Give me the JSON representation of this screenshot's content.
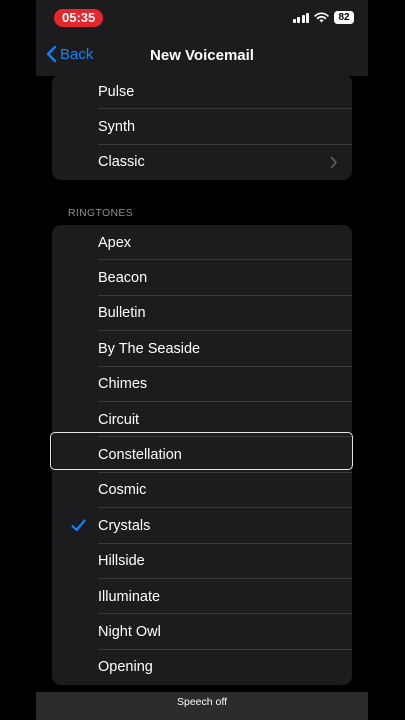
{
  "status_bar": {
    "time": "05:35",
    "battery": "82",
    "time_pill_color": "#e5262d"
  },
  "nav": {
    "back_label": "Back",
    "title": "New Voicemail",
    "accent_color": "#0a84ff"
  },
  "alert_tones": {
    "items": [
      {
        "label": "Pulse"
      },
      {
        "label": "Synth"
      },
      {
        "label": "Classic",
        "icon": "chevron-right-icon"
      }
    ]
  },
  "ringtones": {
    "header": "RINGTONES",
    "selected": "Crystals",
    "items": [
      {
        "label": "Apex"
      },
      {
        "label": "Beacon"
      },
      {
        "label": "Bulletin"
      },
      {
        "label": "By The Seaside"
      },
      {
        "label": "Chimes"
      },
      {
        "label": "Circuit"
      },
      {
        "label": "Constellation"
      },
      {
        "label": "Cosmic"
      },
      {
        "label": "Crystals",
        "icon": "checkmark-icon"
      },
      {
        "label": "Hillside"
      },
      {
        "label": "Illuminate"
      },
      {
        "label": "Night Owl"
      },
      {
        "label": "Opening"
      }
    ]
  },
  "caption": {
    "text": "Speech off"
  }
}
